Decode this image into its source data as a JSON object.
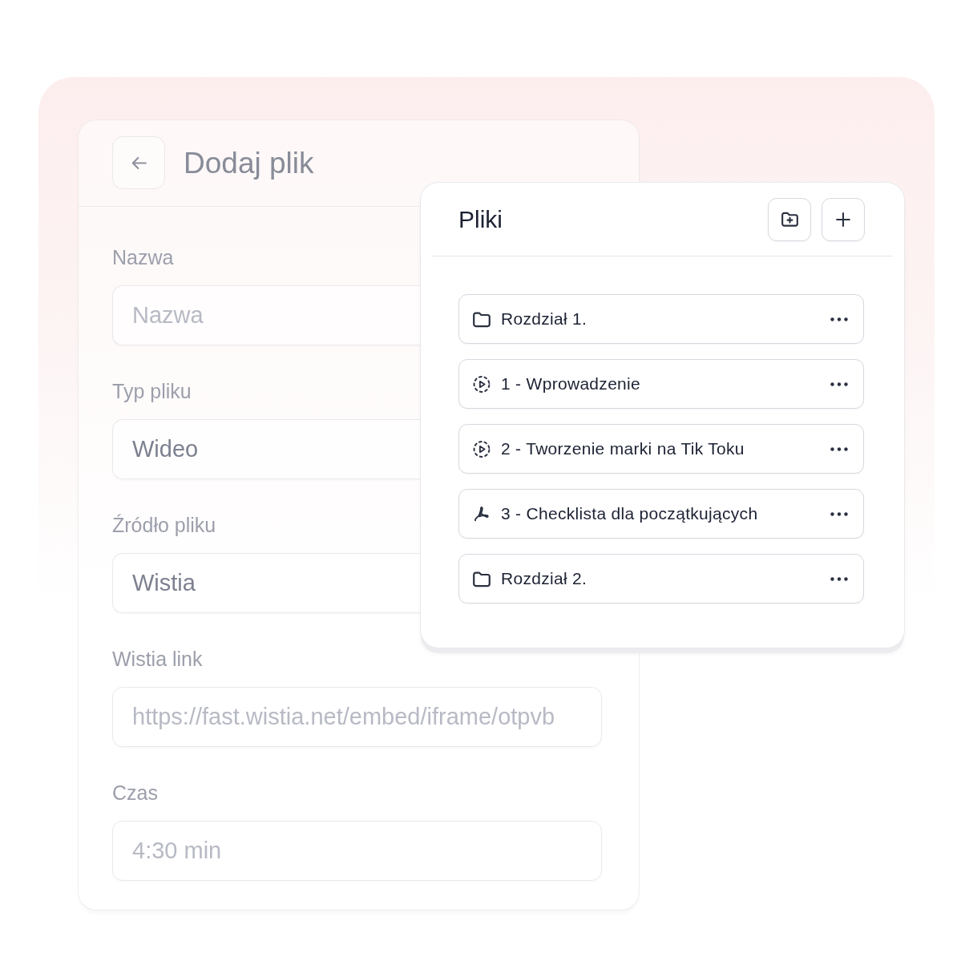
{
  "form": {
    "title": "Dodaj plik",
    "fields": [
      {
        "label": "Nazwa",
        "placeholder": "Nazwa"
      },
      {
        "label": "Typ pliku",
        "value": "Wideo"
      },
      {
        "label": "Źródło pliku",
        "value": "Wistia"
      },
      {
        "label": "Wistia link",
        "placeholder": "https://fast.wistia.net/embed/iframe/otpvb"
      },
      {
        "label": "Czas",
        "placeholder": "4:30 min"
      }
    ]
  },
  "files_panel": {
    "title": "Pliki",
    "items": [
      {
        "kind": "folder",
        "name": "Rozdział 1."
      },
      {
        "kind": "video",
        "name": "1 - Wprowadzenie"
      },
      {
        "kind": "video",
        "name": "2 - Tworzenie marki na Tik Toku"
      },
      {
        "kind": "pdf",
        "name": "3 - Checklista dla początkujących"
      },
      {
        "kind": "folder",
        "name": "Rozdział 2."
      }
    ]
  }
}
